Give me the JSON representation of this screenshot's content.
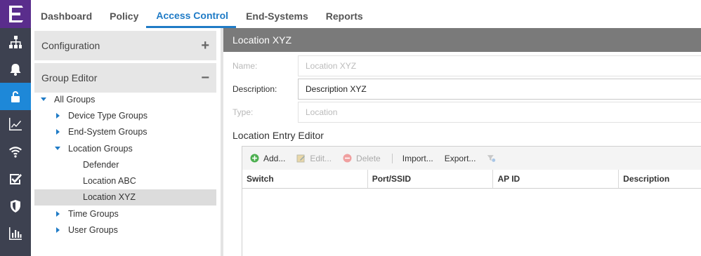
{
  "rail": {
    "logo": "E",
    "items": [
      {
        "icon": "network-icon",
        "active": false
      },
      {
        "icon": "bell-icon",
        "active": false
      },
      {
        "icon": "unlock-icon",
        "active": true
      },
      {
        "icon": "trend-chart-icon",
        "active": false
      },
      {
        "icon": "wifi-icon",
        "active": false
      },
      {
        "icon": "checkbox-icon",
        "active": false
      },
      {
        "icon": "shield-icon",
        "active": false
      },
      {
        "icon": "bar-chart-icon",
        "active": false
      }
    ]
  },
  "topnav": {
    "tabs": [
      {
        "label": "Dashboard",
        "active": false
      },
      {
        "label": "Policy",
        "active": false
      },
      {
        "label": "Access Control",
        "active": true
      },
      {
        "label": "End-Systems",
        "active": false
      },
      {
        "label": "Reports",
        "active": false
      }
    ]
  },
  "left": {
    "configuration": {
      "label": "Configuration",
      "symbol": "+"
    },
    "group_editor": {
      "label": "Group Editor",
      "symbol": "−"
    },
    "tree": [
      {
        "label": "All Groups",
        "level": 0,
        "arrow": "down",
        "selected": false
      },
      {
        "label": "Device Type Groups",
        "level": 1,
        "arrow": "right",
        "selected": false
      },
      {
        "label": "End-System Groups",
        "level": 1,
        "arrow": "right",
        "selected": false
      },
      {
        "label": "Location Groups",
        "level": 1,
        "arrow": "down",
        "selected": false
      },
      {
        "label": "Defender",
        "level": 2,
        "arrow": "none",
        "selected": false
      },
      {
        "label": "Location ABC",
        "level": 2,
        "arrow": "none",
        "selected": false
      },
      {
        "label": "Location XYZ",
        "level": 2,
        "arrow": "none",
        "selected": true
      },
      {
        "label": "Time Groups",
        "level": 1,
        "arrow": "right",
        "selected": false
      },
      {
        "label": "User Groups",
        "level": 1,
        "arrow": "right",
        "selected": false
      }
    ]
  },
  "right": {
    "title": "Location XYZ",
    "fields": {
      "name": {
        "label": "Name:",
        "value": "Location XYZ"
      },
      "description": {
        "label": "Description:",
        "value": "Description XYZ"
      },
      "type": {
        "label": "Type:",
        "value": "Location"
      }
    },
    "section_title": "Location Entry Editor",
    "toolbar": {
      "add": "Add...",
      "edit": "Edit...",
      "delete": "Delete",
      "import": "Import...",
      "export": "Export..."
    },
    "columns": [
      "Switch",
      "Port/SSID",
      "AP ID",
      "Description"
    ],
    "colors": {
      "accent": "#1f7bc6",
      "rail": "#3d4150",
      "logo": "#5a2d8c",
      "title_bar": "#7a7a7a"
    }
  }
}
